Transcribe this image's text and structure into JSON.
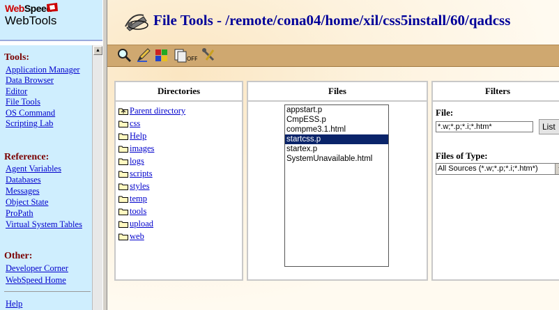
{
  "logo": {
    "brand_web": "Web",
    "brand_speed": "Speed",
    "product": "WebTools"
  },
  "nav": {
    "tools_heading": "Tools:",
    "tools": [
      "Application Manager",
      "Data Browser",
      "Editor",
      "File Tools",
      "OS Command",
      "Scripting Lab"
    ],
    "reference_heading": "Reference:",
    "reference": [
      "Agent Variables",
      "Databases",
      "Messages",
      "Object State",
      "ProPath",
      "Virtual System Tables"
    ],
    "other_heading": "Other:",
    "other": [
      "Developer Corner",
      "WebSpeed Home"
    ],
    "help": "Help"
  },
  "page": {
    "title": "File Tools - /remote/cona04/home/xil/css5install/60/qadcss"
  },
  "toolbar": {
    "icons": [
      "magnifier-icon",
      "pencil-icon",
      "puzzle-icon",
      "files-off-icon",
      "tools-icon"
    ]
  },
  "directories": {
    "header": "Directories",
    "items": [
      "Parent directory",
      "css",
      "Help",
      "images",
      "logs",
      "scripts",
      "styles",
      "temp",
      "tools",
      "upload",
      "web"
    ]
  },
  "files": {
    "header": "Files",
    "items": [
      "appstart.p",
      "CmpESS.p",
      "compme3.1.html",
      "startcss.p",
      "startex.p",
      "SystemUnavailable.html"
    ],
    "selected": "startcss.p"
  },
  "filters": {
    "header": "Filters",
    "file_label": "File:",
    "file_value": "*.w;*.p;*.i;*.htm*",
    "list_button": "List",
    "type_label": "Files of Type:",
    "type_value": "All Sources (*.w;*.p;*.i;*.htm*)"
  },
  "colors": {
    "nav_bg": "#cfeefe",
    "toolbar_bg": "#cfa870",
    "title": "#000099",
    "link": "#0000cc",
    "heading": "#7a0000",
    "selection": "#0a246a"
  }
}
